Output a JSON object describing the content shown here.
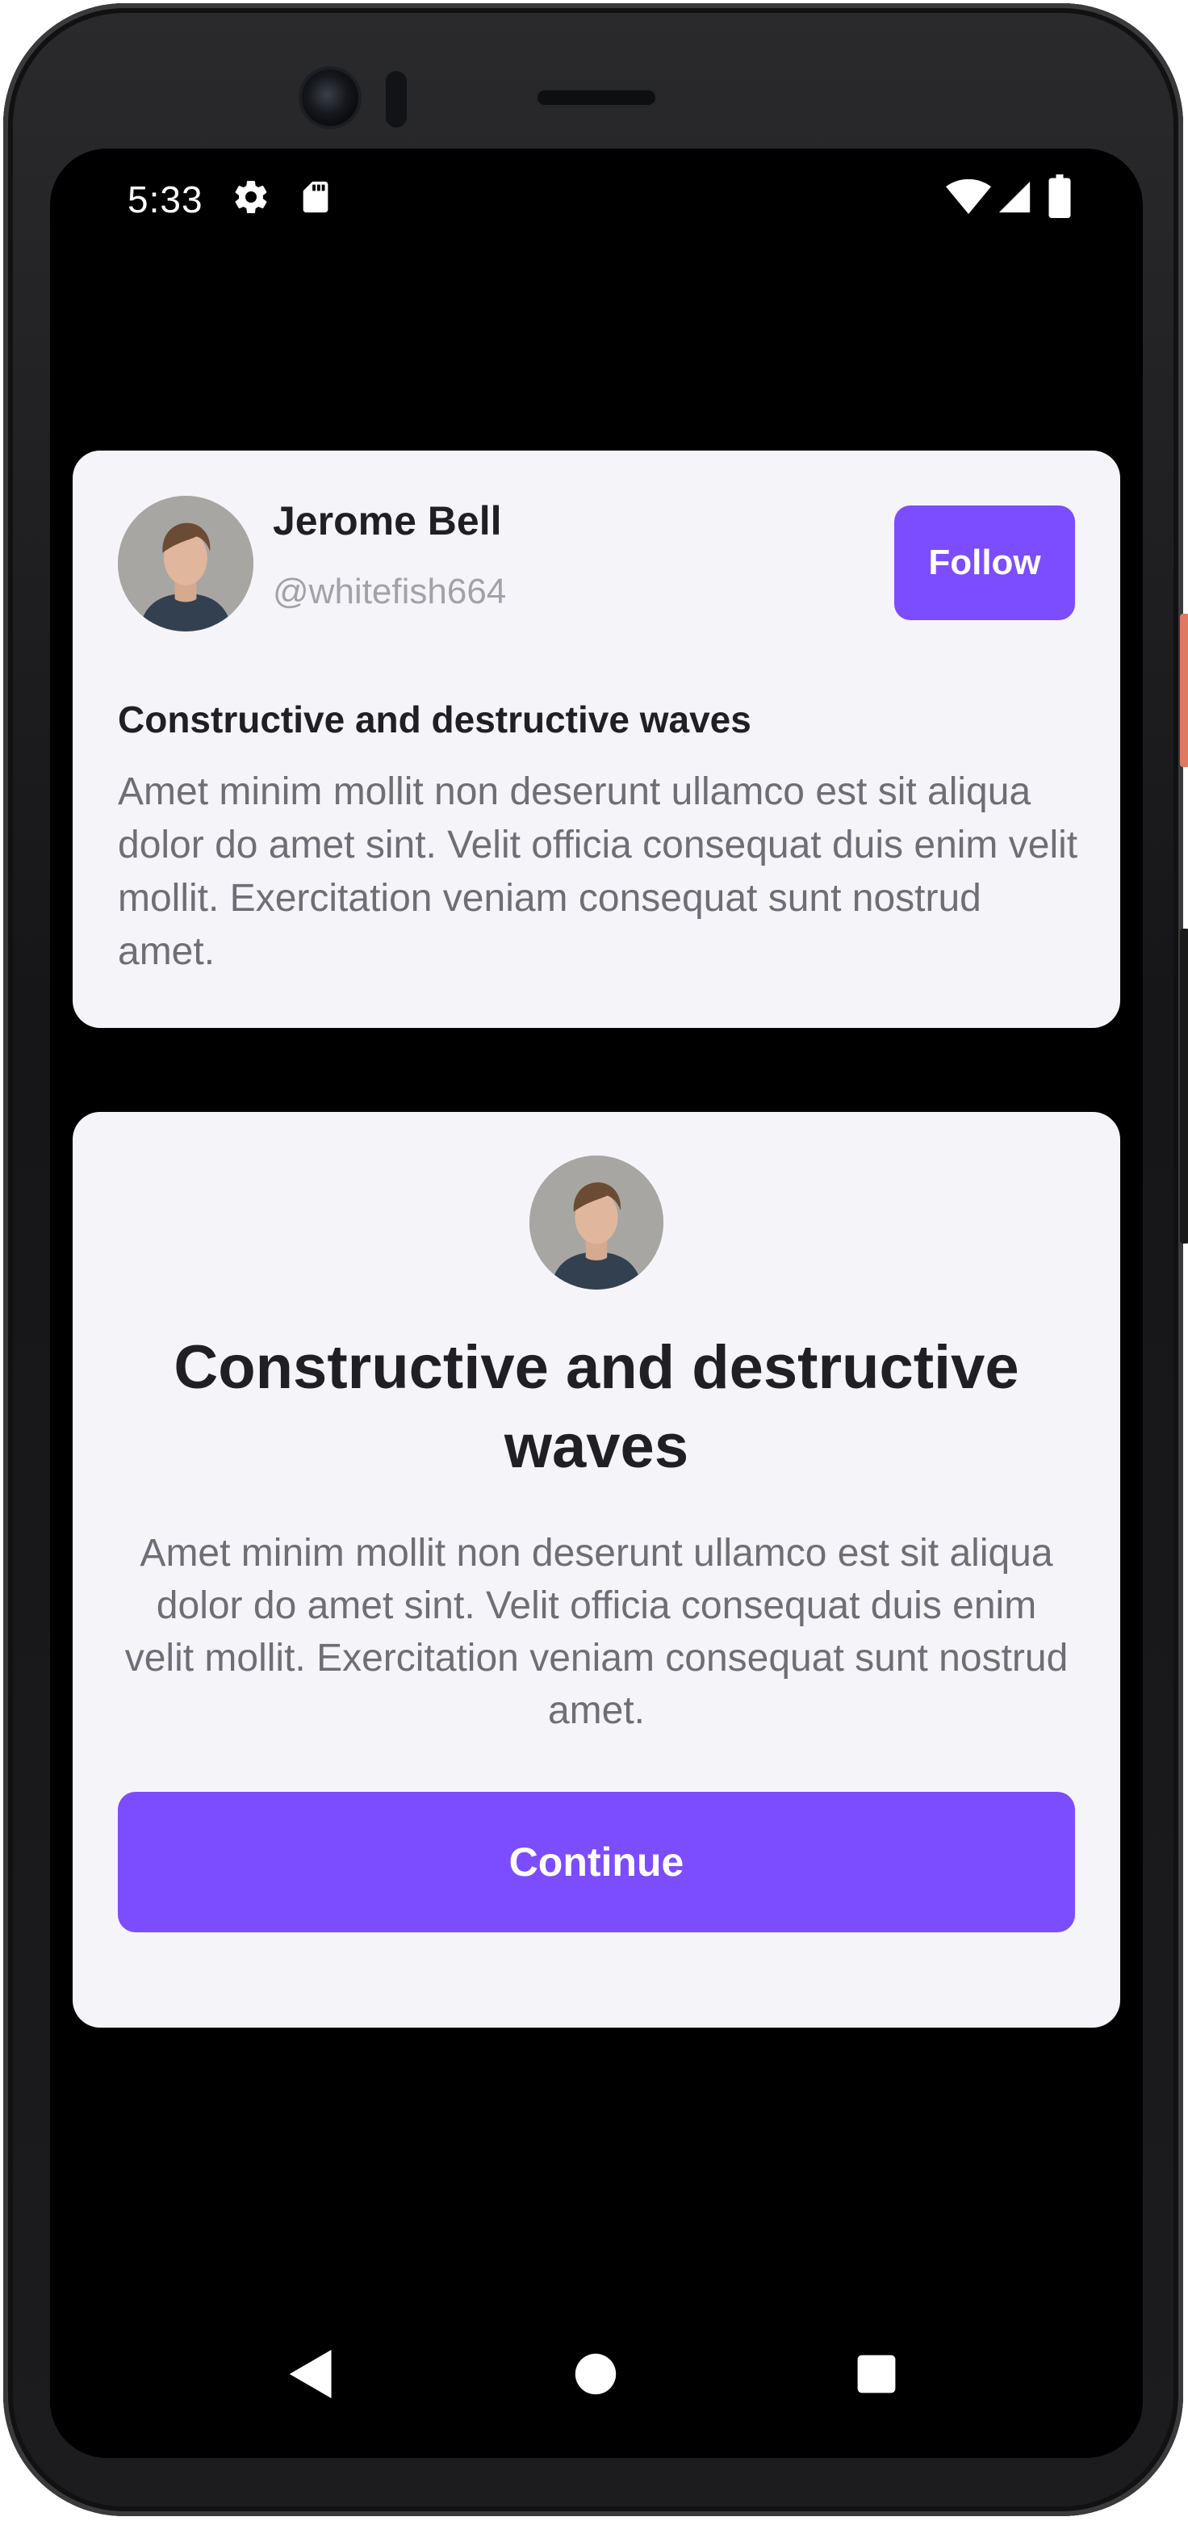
{
  "status_bar": {
    "time": "5:33",
    "icons": [
      "settings-icon",
      "sd-card-icon",
      "wifi-icon",
      "signal-icon",
      "battery-icon"
    ]
  },
  "post_card": {
    "user_name": "Jerome Bell",
    "user_handle": "@whitefish664",
    "follow_label": "Follow",
    "title": "Constructive and destructive waves",
    "body": "Amet minim mollit non deserunt ullamco est sit aliqua dolor do amet sint. Velit officia consequat duis enim velit mollit. Exercitation veniam consequat sunt nostrud amet."
  },
  "modal_card": {
    "title": "Constructive and destructive waves",
    "body": "Amet minim mollit non deserunt ullamco est sit aliqua dolor do amet sint. Velit officia consequat duis enim velit mollit. Exercitation veniam consequat sunt nostrud amet.",
    "continue_label": "Continue"
  },
  "nav_bar": {
    "icons": [
      "back-icon",
      "home-icon",
      "recents-icon"
    ]
  },
  "colors": {
    "accent": "#7c4dff",
    "card_background": "#f5f4f9",
    "screen_background": "#000000",
    "title_text": "#1f1f24",
    "body_text": "#6f6e75",
    "muted_text": "#a3a2a8"
  }
}
